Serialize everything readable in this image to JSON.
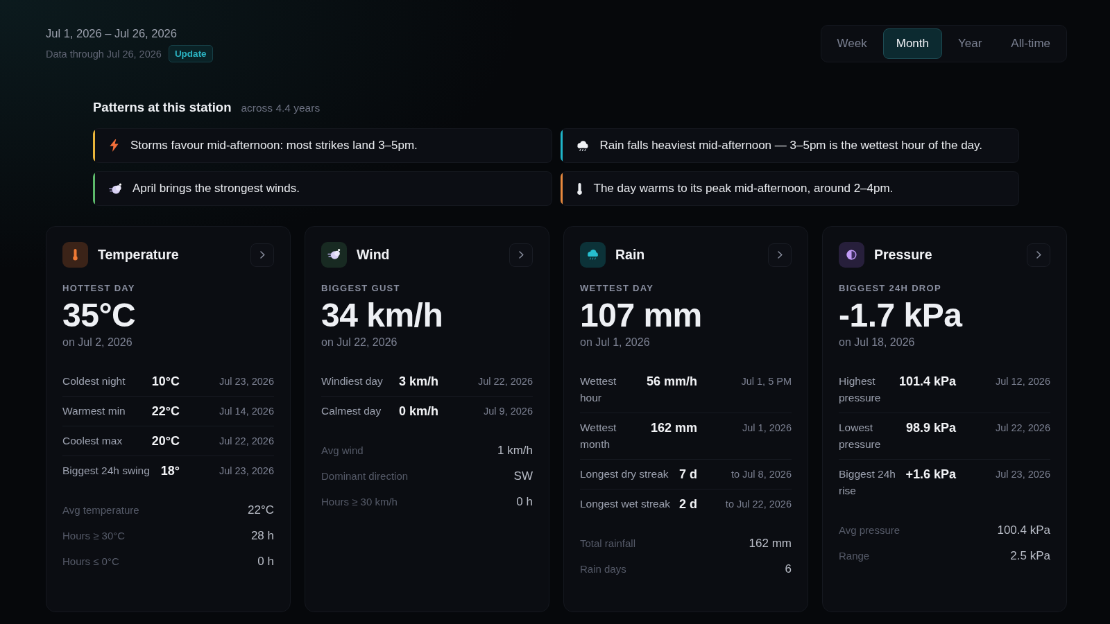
{
  "header": {
    "date_range": "Jul 1, 2026 – Jul 26, 2026",
    "data_through": "Data through Jul 26, 2026",
    "update_button": "Update"
  },
  "period_tabs": [
    {
      "label": "Week",
      "selected": false
    },
    {
      "label": "Month",
      "selected": true
    },
    {
      "label": "Year",
      "selected": false
    },
    {
      "label": "All-time",
      "selected": false
    }
  ],
  "patterns": {
    "title": "Patterns at this station",
    "subtitle": "across 4.4 years",
    "items": [
      {
        "kind": "storm",
        "color": "#e9b43a",
        "text": "Storms favour mid-afternoon: most strikes land 3–5pm."
      },
      {
        "kind": "rain",
        "color": "#1fb5c9",
        "text": "Rain falls heaviest mid-afternoon — 3–5pm is the wettest hour of the day."
      },
      {
        "kind": "wind",
        "color": "#5cb86a",
        "text": "April brings the strongest winds."
      },
      {
        "kind": "temperature",
        "color": "#e98a3e",
        "text": "The day warms to its peak mid-afternoon, around 2–4pm."
      }
    ]
  },
  "cards": [
    {
      "kind": "temperature",
      "title": "Temperature",
      "headline": {
        "label": "HOTTEST DAY",
        "value": "35°C",
        "date": "on Jul 2, 2026"
      },
      "records": [
        {
          "label": "Coldest night",
          "value": "10°C",
          "date": "Jul 23, 2026"
        },
        {
          "label": "Warmest min",
          "value": "22°C",
          "date": "Jul 14, 2026"
        },
        {
          "label": "Coolest max",
          "value": "20°C",
          "date": "Jul 22, 2026"
        },
        {
          "label": "Biggest 24h swing",
          "value": "18°",
          "date": "Jul 23, 2026"
        }
      ],
      "summary": [
        {
          "label": "Avg temperature",
          "value": "22°C"
        },
        {
          "label": "Hours ≥ 30°C",
          "value": "28 h"
        },
        {
          "label": "Hours ≤ 0°C",
          "value": "0 h"
        }
      ]
    },
    {
      "kind": "wind",
      "title": "Wind",
      "headline": {
        "label": "BIGGEST GUST",
        "value": "34 km/h",
        "date": "on Jul 22, 2026"
      },
      "records": [
        {
          "label": "Windiest day",
          "value": "3 km/h",
          "date": "Jul 22, 2026"
        },
        {
          "label": "Calmest day",
          "value": "0 km/h",
          "date": "Jul 9, 2026"
        }
      ],
      "summary": [
        {
          "label": "Avg wind",
          "value": "1 km/h"
        },
        {
          "label": "Dominant direction",
          "value": "SW"
        },
        {
          "label": "Hours ≥ 30 km/h",
          "value": "0 h"
        }
      ]
    },
    {
      "kind": "rain",
      "title": "Rain",
      "headline": {
        "label": "WETTEST DAY",
        "value": "107 mm",
        "date": "on Jul 1, 2026"
      },
      "records": [
        {
          "label": "Wettest hour",
          "value": "56 mm/h",
          "date": "Jul 1, 5 PM"
        },
        {
          "label": "Wettest month",
          "value": "162 mm",
          "date": "Jul 1, 2026"
        },
        {
          "label": "Longest dry streak",
          "value": "7 d",
          "date": "to Jul 8, 2026"
        },
        {
          "label": "Longest wet streak",
          "value": "2 d",
          "date": "to Jul 22, 2026"
        }
      ],
      "summary": [
        {
          "label": "Total rainfall",
          "value": "162 mm"
        },
        {
          "label": "Rain days",
          "value": "6"
        }
      ]
    },
    {
      "kind": "pressure",
      "title": "Pressure",
      "headline": {
        "label": "BIGGEST 24H DROP",
        "value": "-1.7 kPa",
        "date": "on Jul 18, 2026"
      },
      "records": [
        {
          "label": "Highest pressure",
          "value": "101.4 kPa",
          "date": "Jul 12, 2026"
        },
        {
          "label": "Lowest pressure",
          "value": "98.9 kPa",
          "date": "Jul 22, 2026"
        },
        {
          "label": "Biggest 24h rise",
          "value": "+1.6 kPa",
          "date": "Jul 23, 2026"
        }
      ],
      "summary": [
        {
          "label": "Avg pressure",
          "value": "100.4 kPa"
        },
        {
          "label": "Range",
          "value": "2.5 kPa"
        }
      ]
    }
  ]
}
